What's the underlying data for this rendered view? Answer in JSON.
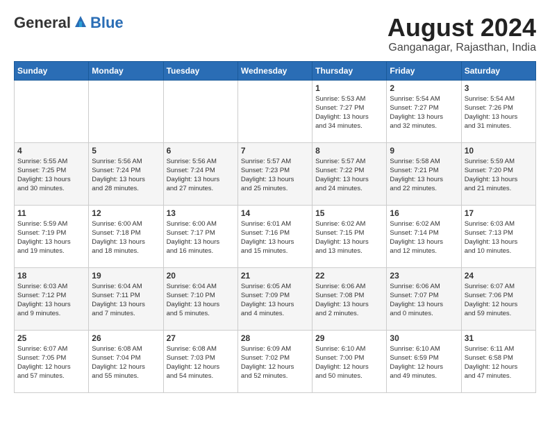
{
  "logo": {
    "general": "General",
    "blue": "Blue"
  },
  "title": "August 2024",
  "subtitle": "Ganganagar, Rajasthan, India",
  "weekdays": [
    "Sunday",
    "Monday",
    "Tuesday",
    "Wednesday",
    "Thursday",
    "Friday",
    "Saturday"
  ],
  "weeks": [
    [
      {
        "day": "",
        "content": ""
      },
      {
        "day": "",
        "content": ""
      },
      {
        "day": "",
        "content": ""
      },
      {
        "day": "",
        "content": ""
      },
      {
        "day": "1",
        "content": "Sunrise: 5:53 AM\nSunset: 7:27 PM\nDaylight: 13 hours\nand 34 minutes."
      },
      {
        "day": "2",
        "content": "Sunrise: 5:54 AM\nSunset: 7:27 PM\nDaylight: 13 hours\nand 32 minutes."
      },
      {
        "day": "3",
        "content": "Sunrise: 5:54 AM\nSunset: 7:26 PM\nDaylight: 13 hours\nand 31 minutes."
      }
    ],
    [
      {
        "day": "4",
        "content": "Sunrise: 5:55 AM\nSunset: 7:25 PM\nDaylight: 13 hours\nand 30 minutes."
      },
      {
        "day": "5",
        "content": "Sunrise: 5:56 AM\nSunset: 7:24 PM\nDaylight: 13 hours\nand 28 minutes."
      },
      {
        "day": "6",
        "content": "Sunrise: 5:56 AM\nSunset: 7:24 PM\nDaylight: 13 hours\nand 27 minutes."
      },
      {
        "day": "7",
        "content": "Sunrise: 5:57 AM\nSunset: 7:23 PM\nDaylight: 13 hours\nand 25 minutes."
      },
      {
        "day": "8",
        "content": "Sunrise: 5:57 AM\nSunset: 7:22 PM\nDaylight: 13 hours\nand 24 minutes."
      },
      {
        "day": "9",
        "content": "Sunrise: 5:58 AM\nSunset: 7:21 PM\nDaylight: 13 hours\nand 22 minutes."
      },
      {
        "day": "10",
        "content": "Sunrise: 5:59 AM\nSunset: 7:20 PM\nDaylight: 13 hours\nand 21 minutes."
      }
    ],
    [
      {
        "day": "11",
        "content": "Sunrise: 5:59 AM\nSunset: 7:19 PM\nDaylight: 13 hours\nand 19 minutes."
      },
      {
        "day": "12",
        "content": "Sunrise: 6:00 AM\nSunset: 7:18 PM\nDaylight: 13 hours\nand 18 minutes."
      },
      {
        "day": "13",
        "content": "Sunrise: 6:00 AM\nSunset: 7:17 PM\nDaylight: 13 hours\nand 16 minutes."
      },
      {
        "day": "14",
        "content": "Sunrise: 6:01 AM\nSunset: 7:16 PM\nDaylight: 13 hours\nand 15 minutes."
      },
      {
        "day": "15",
        "content": "Sunrise: 6:02 AM\nSunset: 7:15 PM\nDaylight: 13 hours\nand 13 minutes."
      },
      {
        "day": "16",
        "content": "Sunrise: 6:02 AM\nSunset: 7:14 PM\nDaylight: 13 hours\nand 12 minutes."
      },
      {
        "day": "17",
        "content": "Sunrise: 6:03 AM\nSunset: 7:13 PM\nDaylight: 13 hours\nand 10 minutes."
      }
    ],
    [
      {
        "day": "18",
        "content": "Sunrise: 6:03 AM\nSunset: 7:12 PM\nDaylight: 13 hours\nand 9 minutes."
      },
      {
        "day": "19",
        "content": "Sunrise: 6:04 AM\nSunset: 7:11 PM\nDaylight: 13 hours\nand 7 minutes."
      },
      {
        "day": "20",
        "content": "Sunrise: 6:04 AM\nSunset: 7:10 PM\nDaylight: 13 hours\nand 5 minutes."
      },
      {
        "day": "21",
        "content": "Sunrise: 6:05 AM\nSunset: 7:09 PM\nDaylight: 13 hours\nand 4 minutes."
      },
      {
        "day": "22",
        "content": "Sunrise: 6:06 AM\nSunset: 7:08 PM\nDaylight: 13 hours\nand 2 minutes."
      },
      {
        "day": "23",
        "content": "Sunrise: 6:06 AM\nSunset: 7:07 PM\nDaylight: 13 hours\nand 0 minutes."
      },
      {
        "day": "24",
        "content": "Sunrise: 6:07 AM\nSunset: 7:06 PM\nDaylight: 12 hours\nand 59 minutes."
      }
    ],
    [
      {
        "day": "25",
        "content": "Sunrise: 6:07 AM\nSunset: 7:05 PM\nDaylight: 12 hours\nand 57 minutes."
      },
      {
        "day": "26",
        "content": "Sunrise: 6:08 AM\nSunset: 7:04 PM\nDaylight: 12 hours\nand 55 minutes."
      },
      {
        "day": "27",
        "content": "Sunrise: 6:08 AM\nSunset: 7:03 PM\nDaylight: 12 hours\nand 54 minutes."
      },
      {
        "day": "28",
        "content": "Sunrise: 6:09 AM\nSunset: 7:02 PM\nDaylight: 12 hours\nand 52 minutes."
      },
      {
        "day": "29",
        "content": "Sunrise: 6:10 AM\nSunset: 7:00 PM\nDaylight: 12 hours\nand 50 minutes."
      },
      {
        "day": "30",
        "content": "Sunrise: 6:10 AM\nSunset: 6:59 PM\nDaylight: 12 hours\nand 49 minutes."
      },
      {
        "day": "31",
        "content": "Sunrise: 6:11 AM\nSunset: 6:58 PM\nDaylight: 12 hours\nand 47 minutes."
      }
    ]
  ]
}
